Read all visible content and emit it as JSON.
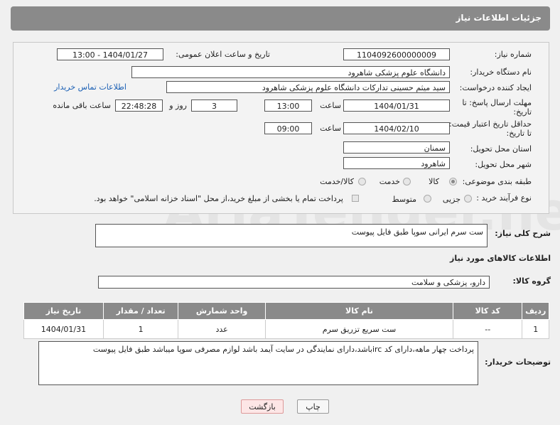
{
  "header": {
    "title": "جزئیات اطلاعات نیاز"
  },
  "form": {
    "need_number_label": "شماره نیاز:",
    "need_number": "1104092600000009",
    "announce_label": "تاریخ و ساعت اعلان عمومی:",
    "announce_value": "1404/01/27 - 13:00",
    "buyer_org_label": "نام دستگاه خریدار:",
    "buyer_org": "دانشگاه علوم پزشکی شاهرود",
    "creator_label": "ایجاد کننده درخواست:",
    "creator": "سید میثم حسینی تدارکات دانشگاه علوم پزشکی شاهرود",
    "contact_link": "اطلاعات تماس خریدار",
    "deadline_label_1": "مهلت ارسال پاسخ: تا",
    "deadline_label_2": "تاریخ:",
    "deadline_date": "1404/01/31",
    "time_label": "ساعت",
    "deadline_time": "13:00",
    "days_value": "3",
    "days_label": "روز و",
    "remaining_time": "22:48:28",
    "remaining_label": "ساعت باقی مانده",
    "validity_label_1": "حداقل تاریخ اعتبار قیمت:",
    "validity_label_2": "تا تاریخ:",
    "validity_date": "1404/02/10",
    "validity_time_label": "ساعت",
    "validity_time": "09:00",
    "province_label": "استان محل تحویل:",
    "province": "سمنان",
    "city_label": "شهر محل تحویل:",
    "city": "شاهرود",
    "category_label": "طبقه بندی موضوعی:",
    "category_options": [
      "کالا",
      "خدمت",
      "کالا/خدمت"
    ],
    "process_label": "نوع فرآیند خرید :",
    "process_options": [
      "جزیی",
      "متوسط"
    ],
    "payment_text": "پرداخت تمام یا بخشی از مبلغ خرید،از محل \"اسناد خزانه اسلامی\" خواهد بود."
  },
  "summary": {
    "label": "شرح کلی نیاز:",
    "value": "ست سرم ایرانی سوپا طبق فایل پیوست"
  },
  "goods_section": {
    "title": "اطلاعات کالاهای مورد نیاز",
    "group_label": "گروه کالا:",
    "group_value": "دارو، پزشکی و سلامت"
  },
  "table": {
    "headers": [
      "ردیف",
      "کد کالا",
      "نام کالا",
      "واحد شمارش",
      "تعداد / مقدار",
      "تاریخ نیاز"
    ],
    "rows": [
      [
        "1",
        "--",
        "ست سریع تزریق سرم",
        "عدد",
        "1",
        "1404/01/31"
      ]
    ]
  },
  "buyer_notes": {
    "label": "توضیحات خریدار:",
    "value": "پرداخت چهار ماهه،دارای کد ircباشد،دارای نمایندگی در سایت آیمد باشد  لوازم مصرفی سوپا میباشد طبق فایل پیوست"
  },
  "buttons": {
    "print": "چاپ",
    "back": "بازگشت"
  },
  "watermark": "AriaTender.neT"
}
